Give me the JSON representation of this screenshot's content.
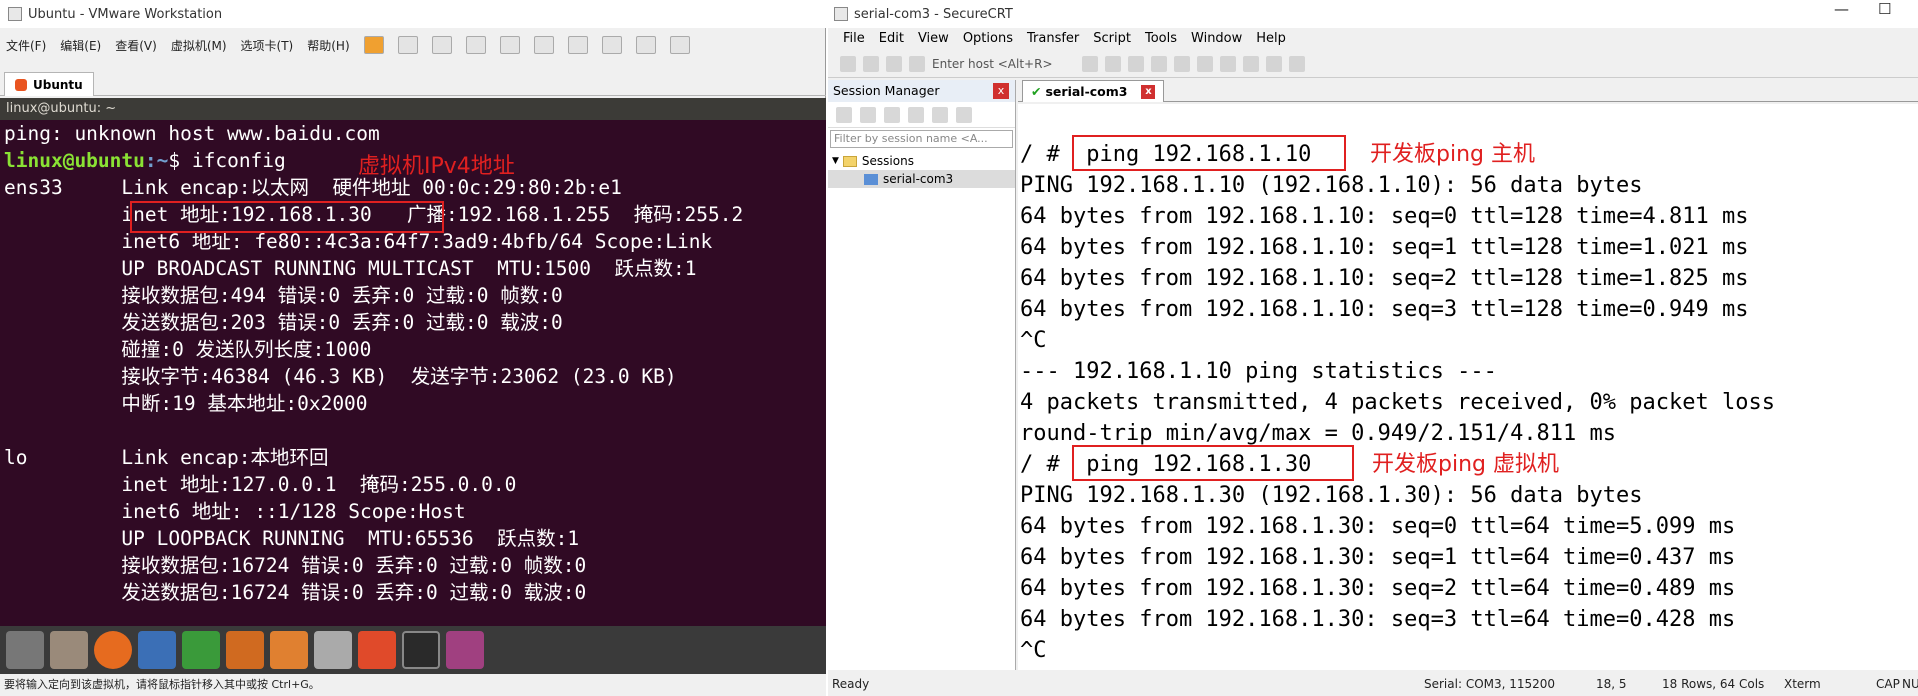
{
  "vm": {
    "title": "Ubuntu - VMware Workstation",
    "menu": [
      "文件(F)",
      "编辑(E)",
      "查看(V)",
      "虚拟机(M)",
      "选项卡(T)",
      "帮助(H)"
    ],
    "tab": "Ubuntu",
    "terminal_title": "linux@ubuntu: ~",
    "lines": [
      "ping: unknown host www.baidu.com",
      "ens33     Link encap:以太网  硬件地址 00:0c:29:80:2b:e1",
      "          inet 地址:192.168.1.30   广播:192.168.1.255  掩码:255.2",
      "          inet6 地址: fe80::4c3a:64f7:3ad9:4bfb/64 Scope:Link",
      "          UP BROADCAST RUNNING MULTICAST  MTU:1500  跃点数:1",
      "          接收数据包:494 错误:0 丢弃:0 过载:0 帧数:0",
      "          发送数据包:203 错误:0 丢弃:0 过载:0 载波:0",
      "          碰撞:0 发送队列长度:1000",
      "          接收字节:46384 (46.3 KB)  发送字节:23062 (23.0 KB)",
      "          中断:19 基本地址:0x2000",
      "",
      "lo        Link encap:本地环回",
      "          inet 地址:127.0.0.1  掩码:255.0.0.0",
      "          inet6 地址: ::1/128 Scope:Host",
      "          UP LOOPBACK RUNNING  MTU:65536  跃点数:1",
      "          接收数据包:16724 错误:0 丢弃:0 过载:0 帧数:0",
      "          发送数据包:16724 错误:0 丢弃:0 过载:0 载波:0"
    ],
    "prompt_user": "linux@ubuntu",
    "prompt_path": ":~",
    "prompt_cmd": "$ ifconfig",
    "annotation": "虚拟机IPv4地址",
    "status": "要将输入定向到该虚拟机，请将鼠标指针移入其中或按 Ctrl+G。"
  },
  "crt": {
    "title": "serial-com3 - SecureCRT",
    "menu": [
      "File",
      "Edit",
      "View",
      "Options",
      "Transfer",
      "Script",
      "Tools",
      "Window",
      "Help"
    ],
    "host_placeholder": "Enter host <Alt+R>",
    "session_manager": "Session Manager",
    "filter_placeholder": "Filter by session name <A...",
    "tree_root": "Sessions",
    "tree_item": "serial-com3",
    "tab": "serial-com3",
    "lines": [
      "",
      "/ #  ping 192.168.1.10",
      "PING 192.168.1.10 (192.168.1.10): 56 data bytes",
      "64 bytes from 192.168.1.10: seq=0 ttl=128 time=4.811 ms",
      "64 bytes from 192.168.1.10: seq=1 ttl=128 time=1.021 ms",
      "64 bytes from 192.168.1.10: seq=2 ttl=128 time=1.825 ms",
      "64 bytes from 192.168.1.10: seq=3 ttl=128 time=0.949 ms",
      "^C",
      "--- 192.168.1.10 ping statistics ---",
      "4 packets transmitted, 4 packets received, 0% packet loss",
      "round-trip min/avg/max = 0.949/2.151/4.811 ms",
      "/ #  ping 192.168.1.30",
      "PING 192.168.1.30 (192.168.1.30): 56 data bytes",
      "64 bytes from 192.168.1.30: seq=0 ttl=64 time=5.099 ms",
      "64 bytes from 192.168.1.30: seq=1 ttl=64 time=0.437 ms",
      "64 bytes from 192.168.1.30: seq=2 ttl=64 time=0.489 ms",
      "64 bytes from 192.168.1.30: seq=3 ttl=64 time=0.428 ms",
      "^C"
    ],
    "annotation1": "开发板ping 主机",
    "annotation2": "开发板ping 虚拟机",
    "status": {
      "ready": "Ready",
      "serial": "Serial: COM3, 115200",
      "pos": "18,  5",
      "size": "18 Rows, 64 Cols",
      "term": "Xterm",
      "caps": "CAP",
      "num": "NU"
    }
  }
}
